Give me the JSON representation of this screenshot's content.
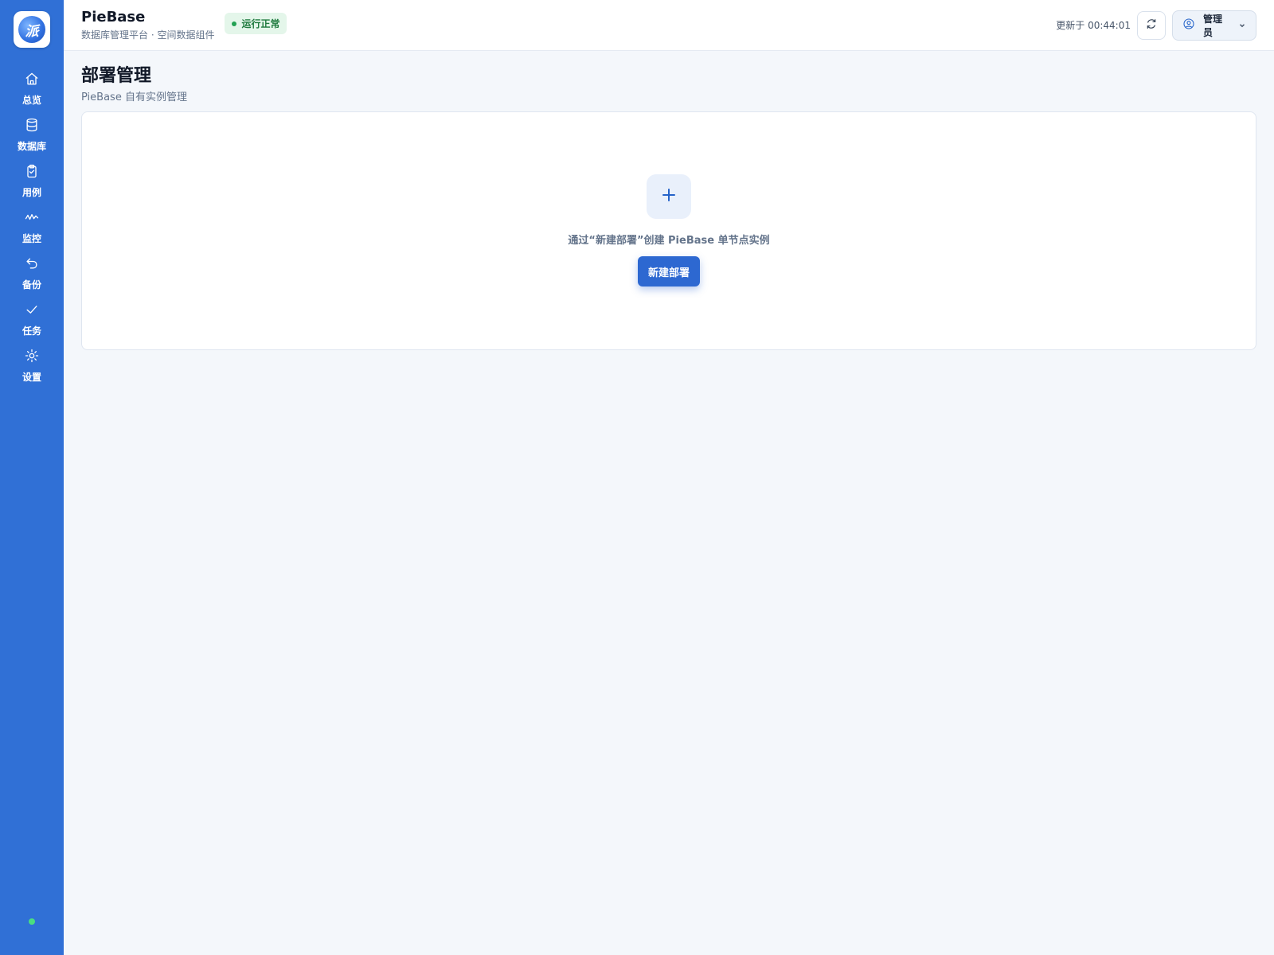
{
  "sidebar": {
    "logo_glyph": "派",
    "items": [
      {
        "label": "总览",
        "icon": "home-icon"
      },
      {
        "label": "数据库",
        "icon": "database-icon"
      },
      {
        "label": "用例",
        "icon": "clipboard-check-icon"
      },
      {
        "label": "监控",
        "icon": "activity-icon"
      },
      {
        "label": "备份",
        "icon": "undo-icon"
      },
      {
        "label": "任务",
        "icon": "check-icon"
      },
      {
        "label": "设置",
        "icon": "sun-gear-icon"
      }
    ],
    "status_color": "#4ade80"
  },
  "header": {
    "title": "PieBase",
    "subtitle": "数据库管理平台 · 空间数据组件",
    "health_badge": "运行正常",
    "updated_text": "更新于 00:44:01",
    "refresh_icon": "refresh-icon",
    "user_name": "管理员"
  },
  "page": {
    "title": "部署管理",
    "subtitle": "PieBase 自有实例管理"
  },
  "empty_state": {
    "icon": "plus-icon",
    "message": "通过“新建部署”创建 PieBase 单节点实例",
    "button_label": "新建部署"
  },
  "colors": {
    "sidebar": "#3070d6",
    "primary_button": "#2d68d1",
    "badge_bg": "#e4f6ea",
    "badge_text": "#1f7a3e"
  }
}
